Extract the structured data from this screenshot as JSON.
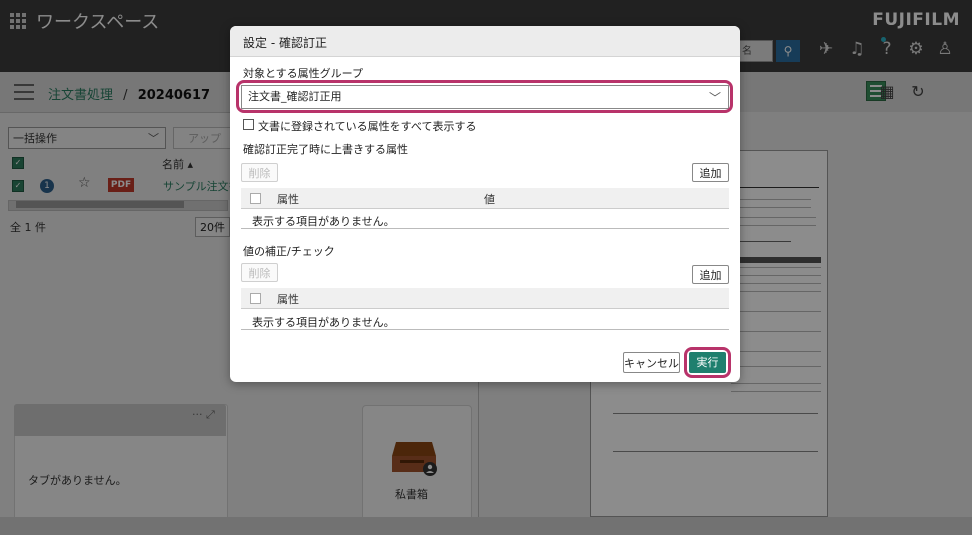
{
  "app": {
    "title": "ワークスペース",
    "brand": "FUJIFILM",
    "search_placeholder": "名"
  },
  "breadcrumb": {
    "root": "注文書処理",
    "separator": "/",
    "current": "20240617"
  },
  "list": {
    "bulk_action": "一括操作",
    "upload": "アップ",
    "column_name": "名前",
    "row_number": "1",
    "row_type": "PDF",
    "row_name": "サンプル注文書",
    "total": "全 1 件",
    "per_page": "20件"
  },
  "panels": {
    "tabs_empty": "タブがありません。",
    "box_label": "私書箱"
  },
  "dialog": {
    "title": "設定 - 確認訂正",
    "group_label": "対象とする属性グループ",
    "group_value": "注文書_確認訂正用",
    "show_all_label": "文書に登録されている属性をすべて表示する",
    "overwrite_label": "確認訂正完了時に上書きする属性",
    "delete_label": "削除",
    "add_label": "追加",
    "col_attribute": "属性",
    "col_value": "値",
    "empty_text": "表示する項目がありません。",
    "correction_label": "値の補正/チェック",
    "cancel_label": "キャンセル",
    "run_label": "実行"
  },
  "colors": {
    "topbar": "#3d3d3d",
    "accent_green": "#1f7f6e",
    "highlight": "#b8336a",
    "pdf_red": "#c0392b"
  }
}
